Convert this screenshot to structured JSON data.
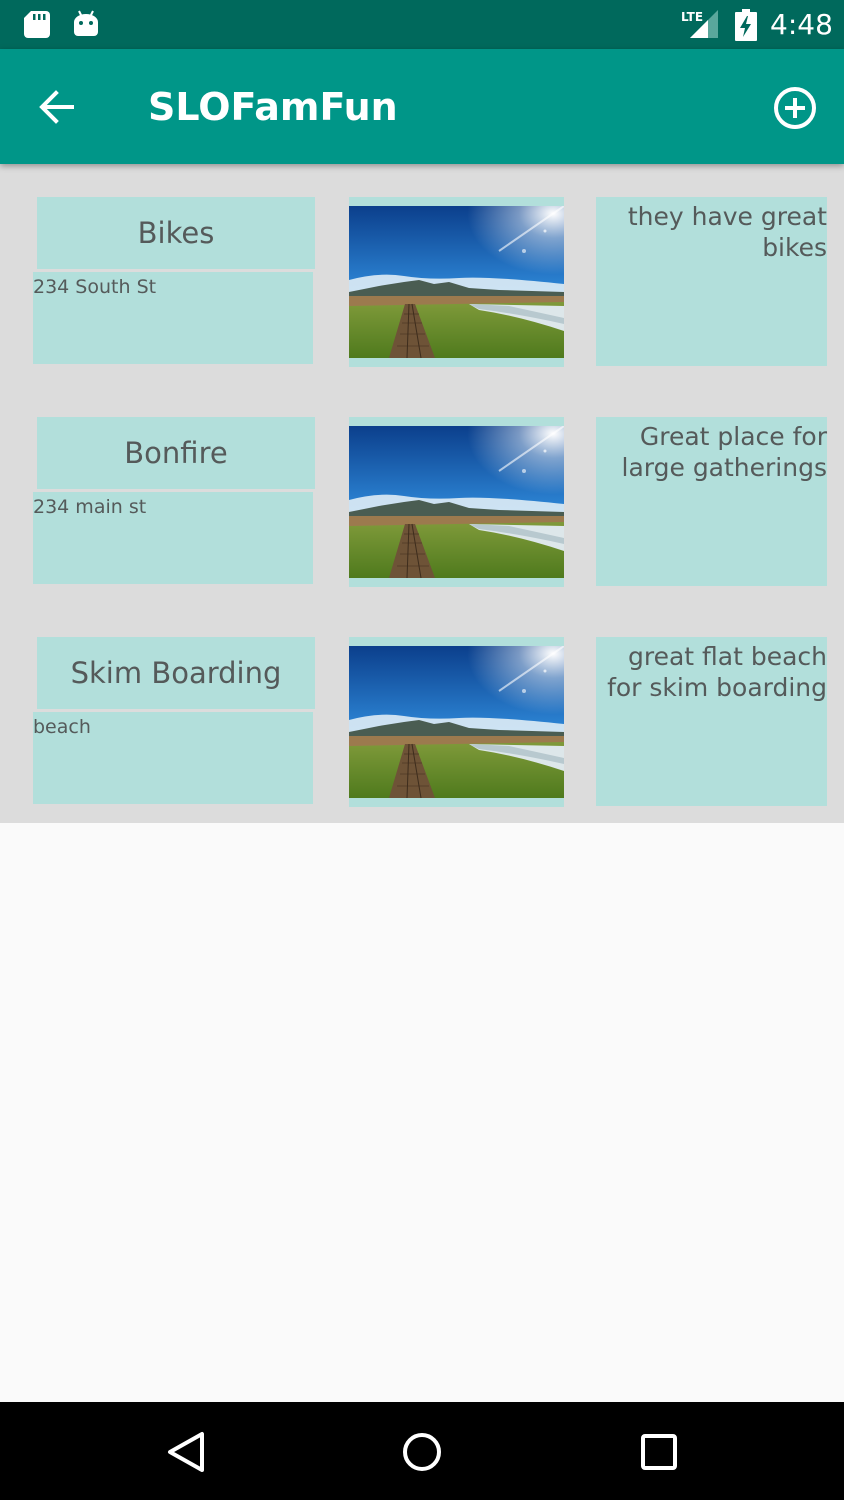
{
  "status_bar": {
    "time": "4:48",
    "network_label": "LTE",
    "icons": [
      "sd-card-icon",
      "android-icon",
      "lte-signal-icon",
      "battery-charging-icon"
    ]
  },
  "app_bar": {
    "title": "SLOFamFun",
    "back_icon": "arrow-back-icon",
    "add_icon": "add-circle-icon"
  },
  "items": [
    {
      "name": "Bikes",
      "address": "234 South St",
      "description": "they have great bikes"
    },
    {
      "name": "Bonfire",
      "address": "234 main st",
      "description": "Great place for large gatherings"
    },
    {
      "name": "Skim Boarding",
      "address": "beach",
      "description": "great flat beach for skim boarding"
    }
  ],
  "nav_bar": {
    "icons": [
      "nav-back-icon",
      "nav-home-icon",
      "nav-recents-icon"
    ]
  },
  "colors": {
    "status_bar": "#00695c",
    "app_bar": "#009688",
    "card": "#b2dfdb",
    "list_background": "#dcdcdc",
    "page_background": "#fafafa"
  }
}
